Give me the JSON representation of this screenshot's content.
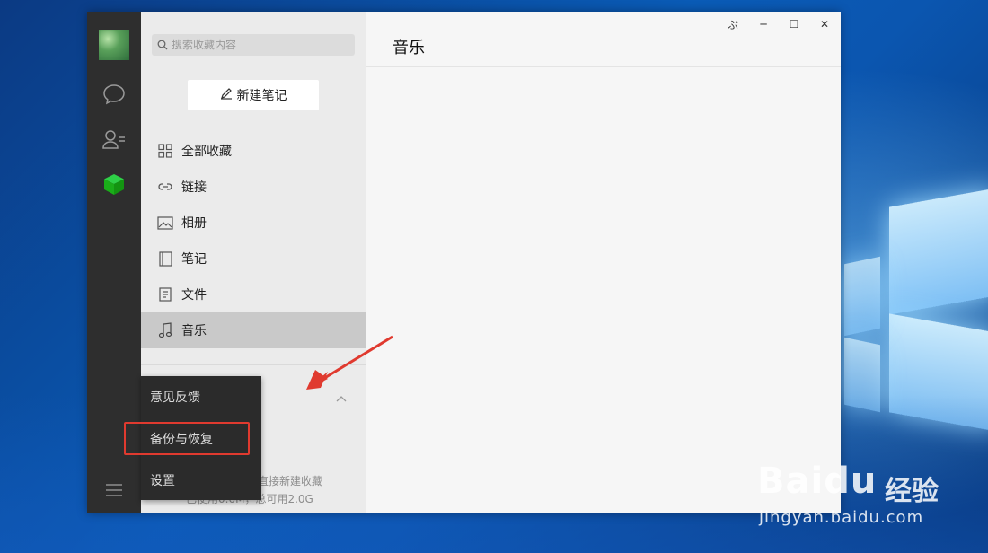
{
  "window": {
    "controls": {
      "pin": "ぷ",
      "minimize": "─",
      "maximize": "☐",
      "close": "✕"
    }
  },
  "search": {
    "placeholder": "搜索收藏内容"
  },
  "new_note": {
    "label": "新建笔记"
  },
  "nav": {
    "items": [
      {
        "label": "全部收藏",
        "icon": "grid-icon"
      },
      {
        "label": "链接",
        "icon": "link-icon"
      },
      {
        "label": "相册",
        "icon": "image-icon"
      },
      {
        "label": "笔记",
        "icon": "notebook-icon"
      },
      {
        "label": "文件",
        "icon": "document-icon"
      },
      {
        "label": "音乐",
        "icon": "music-note-icon",
        "active": true
      }
    ]
  },
  "main": {
    "title": "音乐"
  },
  "storage": {
    "line1": "直接新建收藏",
    "line2": "已使用0.0M，总可用2.0G"
  },
  "menu": {
    "items": [
      {
        "label": "意见反馈"
      },
      {
        "label": "备份与恢复",
        "highlighted": true
      },
      {
        "label": "设置"
      }
    ]
  },
  "watermark": {
    "brand": "Baidu",
    "cn": "经验",
    "url": "jingyan.baidu.com"
  },
  "colors": {
    "accent": "#1aad19",
    "annotation": "#e03a2f"
  }
}
